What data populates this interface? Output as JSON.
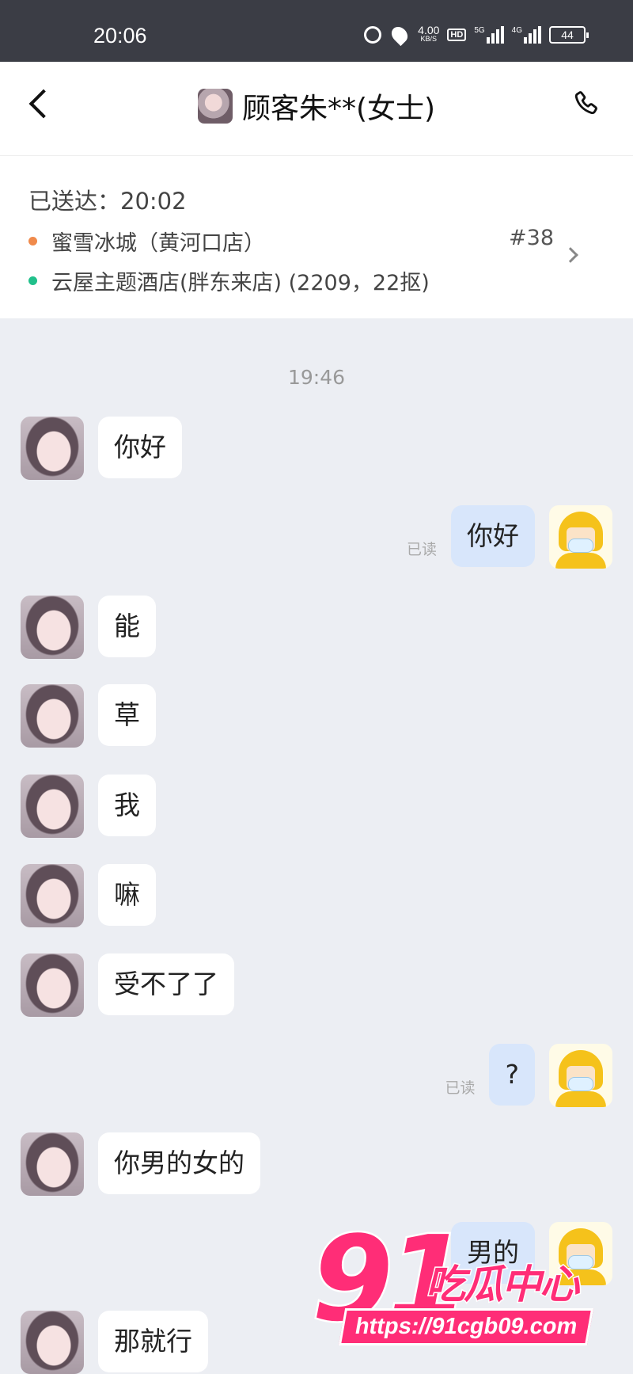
{
  "status_bar": {
    "time": "20:06",
    "speed_value": "4.00",
    "speed_unit": "KB/S",
    "hd_badge": "HD",
    "net1": "5G",
    "net2": "4G",
    "battery": "44"
  },
  "header": {
    "title": "顾客朱**(女士)"
  },
  "order": {
    "delivered": "已送达：20:02",
    "store": "蜜雪冰城（黄河口店）",
    "order_no": "#38",
    "destination": "云屋主题酒店(胖东来店) (2209，22抠)",
    "store_dot_color": "#f08a4b",
    "dest_dot_color": "#21c08b"
  },
  "chat": {
    "timestamp": "19:46",
    "read_label": "已读",
    "messages": [
      {
        "side": "left",
        "text": "你好"
      },
      {
        "side": "right",
        "text": "你好"
      },
      {
        "side": "left",
        "text": "能"
      },
      {
        "side": "left",
        "text": "草"
      },
      {
        "side": "left",
        "text": "我"
      },
      {
        "side": "left",
        "text": "嘛"
      },
      {
        "side": "left",
        "text": "受不了了"
      },
      {
        "side": "right",
        "text": "?"
      },
      {
        "side": "left",
        "text": "你男的女的"
      },
      {
        "side": "right",
        "text": "男的"
      },
      {
        "side": "left",
        "text": "那就行"
      }
    ]
  },
  "watermark": {
    "number": "91",
    "brand": "吃瓜中心",
    "url": "https://91cgb09.com"
  }
}
